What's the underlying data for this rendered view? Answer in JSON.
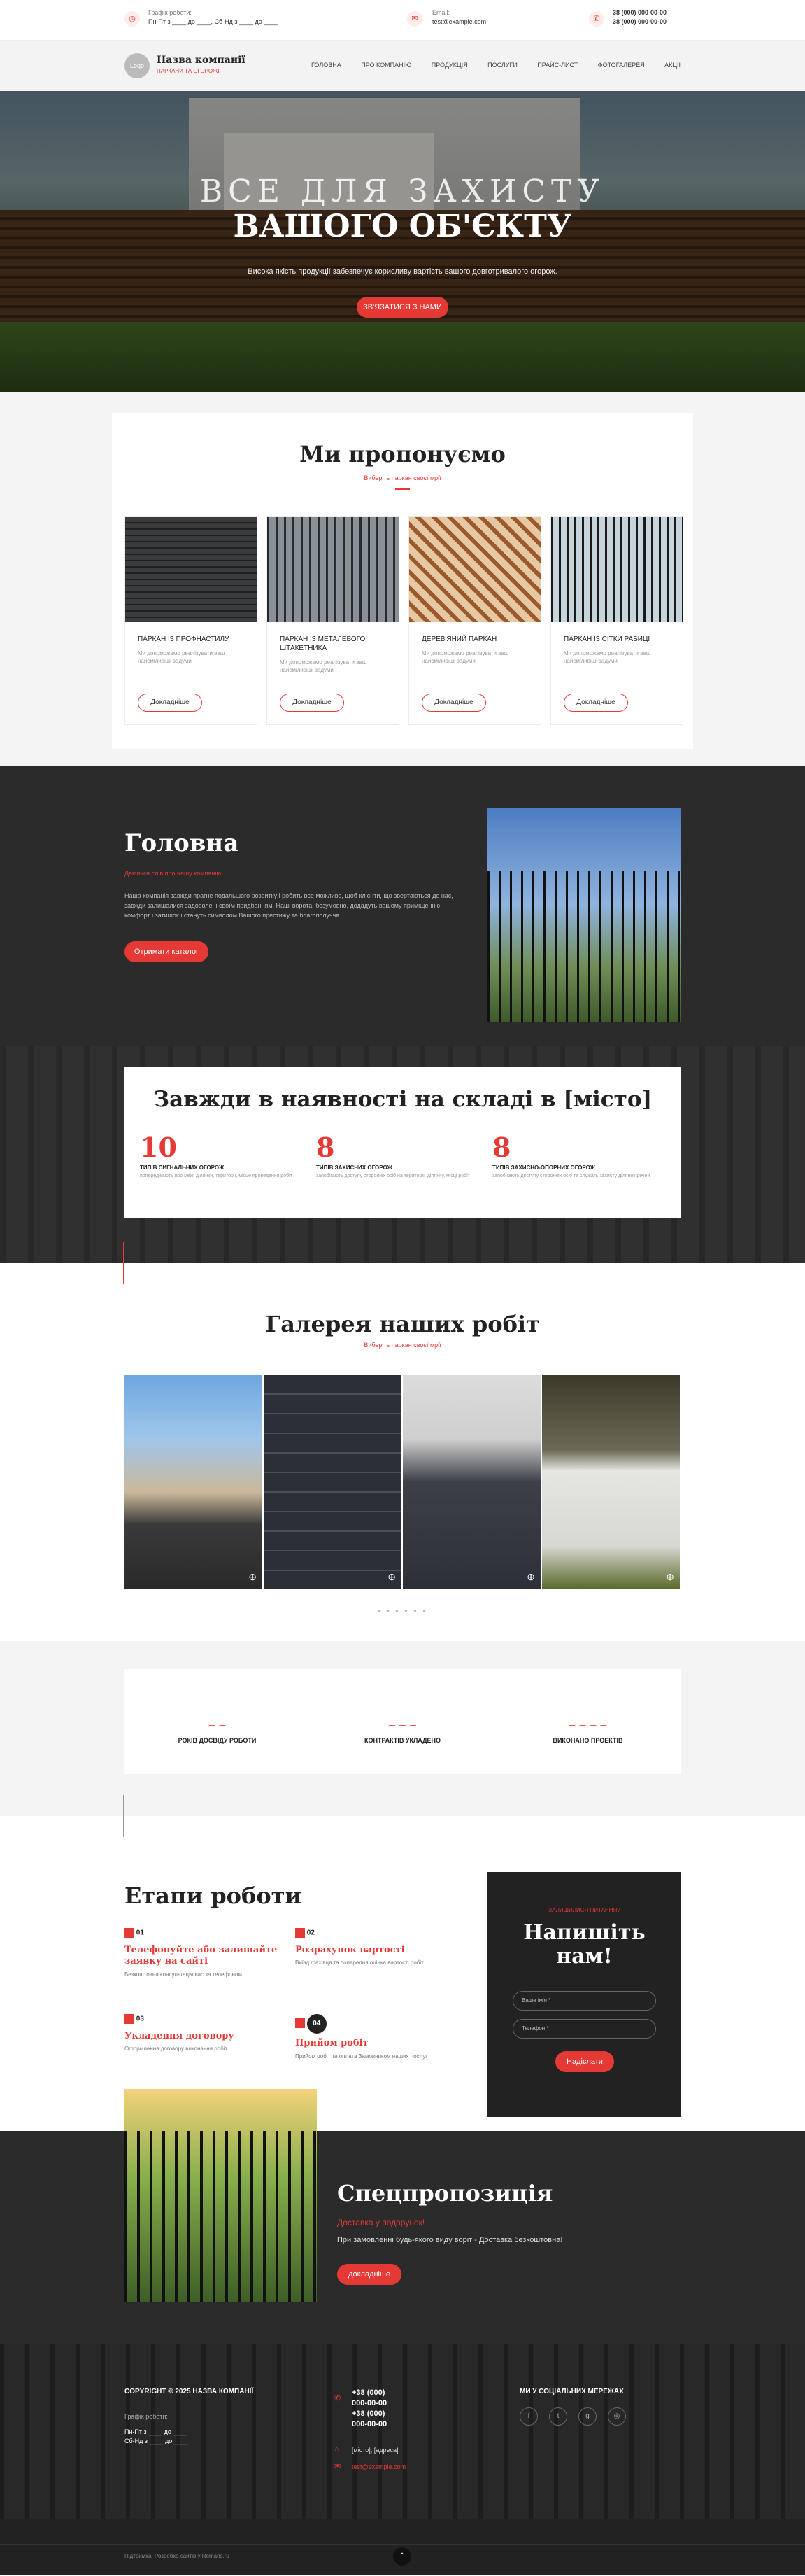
{
  "topbar": {
    "hours_label": "Графік роботи:",
    "hours_value": "Пн-Пт з ____ до ____, Сб-Нд з ____ до ____",
    "email_label": "Email:",
    "email_value": "test@example.com",
    "phone1": "38 (000) 000-00-00",
    "phone2": "38 (000) 000-00-00"
  },
  "header": {
    "logo_text": "Logo",
    "company": "Назва компанії",
    "tagline": "ПАРКАНИ ТА ОГОРОЖІ",
    "nav": [
      "ГОЛОВНА",
      "ПРО КОМПАНІЮ",
      "ПРОДУКЦІЯ",
      "ПОСЛУГИ",
      "ПРАЙС-ЛИСТ",
      "ФОТОГАЛЕРЕЯ",
      "АКЦІЇ"
    ]
  },
  "hero": {
    "line1": "ВСЕ ДЛЯ ЗАХИСТУ",
    "line2": "ВАШОГО ОБ'ЄКТУ",
    "subtitle": "Висока якість продукції забезпечує корисливу вартість вашого довготривалого огорож.",
    "cta": "ЗВ'ЯЗАТИСЯ З НАМИ"
  },
  "offer": {
    "title": "Ми пропонуємо",
    "subtitle": "Виберіть паркан своєї мрії",
    "cards": [
      {
        "title": "ПАРКАН ІЗ ПРОФНАСТИЛУ",
        "desc": "Ми допоможемо реалізувати ваш найсміливіші задуми",
        "button": "Докладніше"
      },
      {
        "title": "ПАРКАН ІЗ МЕТАЛЕВОГО ШТАКЕТНИКА",
        "desc": "Ми допоможемо реалізувати ваш найсміливіші задуми",
        "button": "Докладніше"
      },
      {
        "title": "ДЕРЕВ'ЯНИЙ ПАРКАН",
        "desc": "Ми допоможемо реалізувати ваш найсміливіші задуми",
        "button": "Докладніше"
      },
      {
        "title": "ПАРКАН ІЗ СІТКИ РАБИЦІ",
        "desc": "Ми допоможемо реалізувати ваш найсміливіші задуми",
        "button": "Докладніше"
      }
    ]
  },
  "main": {
    "title": "Головна",
    "subtitle": "Декілька слів про нашу компанію",
    "text": "Наша компанія завжди прагне подальшого розвитку і робить все можливе, щоб клієнти, що звертаються до нас, завжди залишалися задоволені своїм придбанням. Наші ворота, безумовно, додадуть вашому приміщенню комфорт і затишок і стануть символом Вашого престижу та благополуччя.",
    "cta": "Отримати каталог"
  },
  "stock": {
    "title": "Завжди в наявності на складі в [місто]",
    "items": [
      {
        "num": "10",
        "title": "ТИПІВ СИГНАЛЬНИХ ОГОРОЖ",
        "desc": "попереджають про межі ділянки, території, місце проведення робіт"
      },
      {
        "num": "8",
        "title": "ТИПІВ ЗАХИСНИХ ОГОРОЖ",
        "desc": "запобігають доступу сторонніх осіб на території, ділянку, місці робіт"
      },
      {
        "num": "8",
        "title": "ТИПІВ ЗАХИСНО-ОПОРНИХ ОГОРОЖ",
        "desc": "запобігають доступу сторонніх осіб та служать захисту ділянок речей"
      }
    ]
  },
  "gallery": {
    "title": "Галерея наших робіт",
    "subtitle": "Виберіть паркан своєї мрії"
  },
  "counters": {
    "items": [
      {
        "value": "– –",
        "label": "РОКІВ ДОСВІДУ РОБОТИ"
      },
      {
        "value": "– – –",
        "label": "КОНТРАКТІВ УКЛАДЕНО"
      },
      {
        "value": "– – – –",
        "label": "ВИКОНАНО ПРОЕКТІВ"
      }
    ]
  },
  "stages": {
    "title": "Етапи роботи",
    "steps": [
      {
        "num": "01",
        "title": "Телефонуйте або залишайте заявку на сайті",
        "desc": "Безкоштовна консультація вас за телефоном"
      },
      {
        "num": "02",
        "title": "Розрахунок вартості",
        "desc": "Виїзд фахівця та попередня оцінка вартості робіт"
      },
      {
        "num": "03",
        "title": "Укладення договору",
        "desc": "Оформлення договору виконання робіт"
      },
      {
        "num": "04",
        "title": "Прийом робіт",
        "desc": "Прийом робіт та оплата Замовником наших послуг"
      }
    ]
  },
  "form": {
    "pre": "ЗАЛИШИЛИСЯ ПИТАННЯ?",
    "title": "Напишіть нам!",
    "name_placeholder": "Ваше ім'я *",
    "phone_placeholder": "Телефон *",
    "submit": "Надіслати"
  },
  "special": {
    "title": "Спецпропозиція",
    "subtitle": "Доставка у подарунок!",
    "text": "При замовленні будь-якого виду воріт - Доставка безкоштовна!",
    "button": "докладніше"
  },
  "footer": {
    "copyright": "COPYRIGHT © 2025 НАЗВА КОМПАНІЇ",
    "hours_label": "Графік роботи:",
    "hours1": "Пн-Пт з ____ до ____",
    "hours2": "Сб-Нд з ____ до ____",
    "phones": [
      "+38 (000)",
      "000-00-00",
      "+38 (000)",
      "000-00-00"
    ],
    "address": "[місто], [адреса]",
    "email": "test@example.com",
    "social_title": "МИ У СОЦІАЛЬНИХ МЕРЕЖАХ",
    "bottom": "Підтримка: Розробка сайтів у Romaris.ru"
  },
  "colors": {
    "accent": "#e53935",
    "dark": "#2b2b2b"
  }
}
